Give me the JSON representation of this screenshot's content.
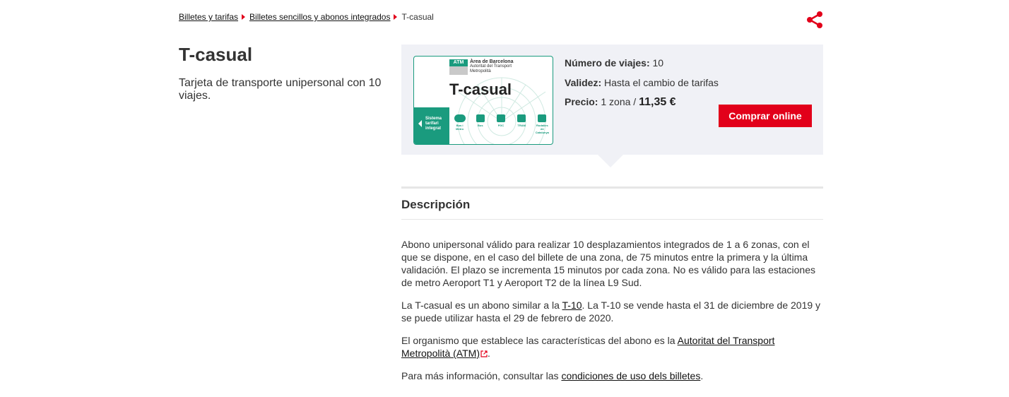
{
  "breadcrumb": {
    "items": [
      "Billetes y tarifas",
      "Billetes sencillos y abonos integrados"
    ],
    "current": "T-casual"
  },
  "page": {
    "title": "T-casual",
    "lead": "Tarjeta de transporte unipersonal con 10 viajes."
  },
  "card": {
    "atm": "ATM",
    "issuer_line1": "Àrea de Barcelona",
    "issuer_line2": "Autoritat del Transport",
    "issuer_line3": "Metropolità",
    "title": "T-casual",
    "strip_text": "Sistema tarifari integrat",
    "modes": [
      "Bus i Metro",
      "Bus",
      "FGC",
      "TRAM",
      "Rodalies de Catalunya"
    ]
  },
  "ticket": {
    "viajes_label": "Número de viajes:",
    "viajes_value": "10",
    "validez_label": "Validez:",
    "validez_value": "Hasta el cambio de tarifas",
    "precio_label": "Precio:",
    "precio_zona": "1 zona /",
    "precio_value": "11,35 €",
    "buy_label": "Comprar online"
  },
  "description": {
    "title": "Descripción",
    "p1": "Abono unipersonal válido para realizar 10 desplazamientos integrados de 1 a 6 zonas, con el que se dispone, en el caso del billete de una zona, de 75 minutos entre la primera y la última validación. El plazo se incrementa 15 minutos por cada zona. No es válido para las estaciones de metro Aeroport T1 y Aeroport T2 de la línea L9 Sud.",
    "p2_before": "La T-casual es un abono similar a la ",
    "p2_link": "T-10",
    "p2_after": ". La T-10 se vende hasta el 31 de diciembre de 2019 y se puede utilizar hasta el 29 de febrero de 2020.",
    "p3_before": "El organismo que establece las características del abono es la ",
    "p3_link": "Autoritat del Transport Metropolità (ATM)",
    "p3_after": ".",
    "p4_before": "Para más información, consultar las ",
    "p4_link": "condiciones de uso dels billetes",
    "p4_after": "."
  },
  "colors": {
    "accent": "#e2001a",
    "card_green": "#1a9b7e",
    "panel_bg": "#f0f1f6"
  }
}
